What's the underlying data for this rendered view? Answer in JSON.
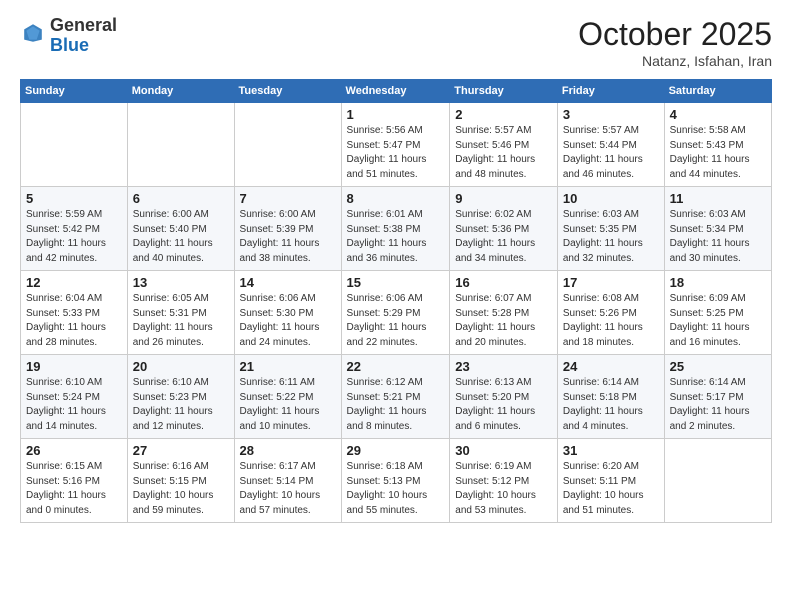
{
  "logo": {
    "general": "General",
    "blue": "Blue"
  },
  "header": {
    "month": "October 2025",
    "location": "Natanz, Isfahan, Iran"
  },
  "weekdays": [
    "Sunday",
    "Monday",
    "Tuesday",
    "Wednesday",
    "Thursday",
    "Friday",
    "Saturday"
  ],
  "weeks": [
    [
      {
        "day": "",
        "info": ""
      },
      {
        "day": "",
        "info": ""
      },
      {
        "day": "",
        "info": ""
      },
      {
        "day": "1",
        "info": "Sunrise: 5:56 AM\nSunset: 5:47 PM\nDaylight: 11 hours\nand 51 minutes."
      },
      {
        "day": "2",
        "info": "Sunrise: 5:57 AM\nSunset: 5:46 PM\nDaylight: 11 hours\nand 48 minutes."
      },
      {
        "day": "3",
        "info": "Sunrise: 5:57 AM\nSunset: 5:44 PM\nDaylight: 11 hours\nand 46 minutes."
      },
      {
        "day": "4",
        "info": "Sunrise: 5:58 AM\nSunset: 5:43 PM\nDaylight: 11 hours\nand 44 minutes."
      }
    ],
    [
      {
        "day": "5",
        "info": "Sunrise: 5:59 AM\nSunset: 5:42 PM\nDaylight: 11 hours\nand 42 minutes."
      },
      {
        "day": "6",
        "info": "Sunrise: 6:00 AM\nSunset: 5:40 PM\nDaylight: 11 hours\nand 40 minutes."
      },
      {
        "day": "7",
        "info": "Sunrise: 6:00 AM\nSunset: 5:39 PM\nDaylight: 11 hours\nand 38 minutes."
      },
      {
        "day": "8",
        "info": "Sunrise: 6:01 AM\nSunset: 5:38 PM\nDaylight: 11 hours\nand 36 minutes."
      },
      {
        "day": "9",
        "info": "Sunrise: 6:02 AM\nSunset: 5:36 PM\nDaylight: 11 hours\nand 34 minutes."
      },
      {
        "day": "10",
        "info": "Sunrise: 6:03 AM\nSunset: 5:35 PM\nDaylight: 11 hours\nand 32 minutes."
      },
      {
        "day": "11",
        "info": "Sunrise: 6:03 AM\nSunset: 5:34 PM\nDaylight: 11 hours\nand 30 minutes."
      }
    ],
    [
      {
        "day": "12",
        "info": "Sunrise: 6:04 AM\nSunset: 5:33 PM\nDaylight: 11 hours\nand 28 minutes."
      },
      {
        "day": "13",
        "info": "Sunrise: 6:05 AM\nSunset: 5:31 PM\nDaylight: 11 hours\nand 26 minutes."
      },
      {
        "day": "14",
        "info": "Sunrise: 6:06 AM\nSunset: 5:30 PM\nDaylight: 11 hours\nand 24 minutes."
      },
      {
        "day": "15",
        "info": "Sunrise: 6:06 AM\nSunset: 5:29 PM\nDaylight: 11 hours\nand 22 minutes."
      },
      {
        "day": "16",
        "info": "Sunrise: 6:07 AM\nSunset: 5:28 PM\nDaylight: 11 hours\nand 20 minutes."
      },
      {
        "day": "17",
        "info": "Sunrise: 6:08 AM\nSunset: 5:26 PM\nDaylight: 11 hours\nand 18 minutes."
      },
      {
        "day": "18",
        "info": "Sunrise: 6:09 AM\nSunset: 5:25 PM\nDaylight: 11 hours\nand 16 minutes."
      }
    ],
    [
      {
        "day": "19",
        "info": "Sunrise: 6:10 AM\nSunset: 5:24 PM\nDaylight: 11 hours\nand 14 minutes."
      },
      {
        "day": "20",
        "info": "Sunrise: 6:10 AM\nSunset: 5:23 PM\nDaylight: 11 hours\nand 12 minutes."
      },
      {
        "day": "21",
        "info": "Sunrise: 6:11 AM\nSunset: 5:22 PM\nDaylight: 11 hours\nand 10 minutes."
      },
      {
        "day": "22",
        "info": "Sunrise: 6:12 AM\nSunset: 5:21 PM\nDaylight: 11 hours\nand 8 minutes."
      },
      {
        "day": "23",
        "info": "Sunrise: 6:13 AM\nSunset: 5:20 PM\nDaylight: 11 hours\nand 6 minutes."
      },
      {
        "day": "24",
        "info": "Sunrise: 6:14 AM\nSunset: 5:18 PM\nDaylight: 11 hours\nand 4 minutes."
      },
      {
        "day": "25",
        "info": "Sunrise: 6:14 AM\nSunset: 5:17 PM\nDaylight: 11 hours\nand 2 minutes."
      }
    ],
    [
      {
        "day": "26",
        "info": "Sunrise: 6:15 AM\nSunset: 5:16 PM\nDaylight: 11 hours\nand 0 minutes."
      },
      {
        "day": "27",
        "info": "Sunrise: 6:16 AM\nSunset: 5:15 PM\nDaylight: 10 hours\nand 59 minutes."
      },
      {
        "day": "28",
        "info": "Sunrise: 6:17 AM\nSunset: 5:14 PM\nDaylight: 10 hours\nand 57 minutes."
      },
      {
        "day": "29",
        "info": "Sunrise: 6:18 AM\nSunset: 5:13 PM\nDaylight: 10 hours\nand 55 minutes."
      },
      {
        "day": "30",
        "info": "Sunrise: 6:19 AM\nSunset: 5:12 PM\nDaylight: 10 hours\nand 53 minutes."
      },
      {
        "day": "31",
        "info": "Sunrise: 6:20 AM\nSunset: 5:11 PM\nDaylight: 10 hours\nand 51 minutes."
      },
      {
        "day": "",
        "info": ""
      }
    ]
  ]
}
